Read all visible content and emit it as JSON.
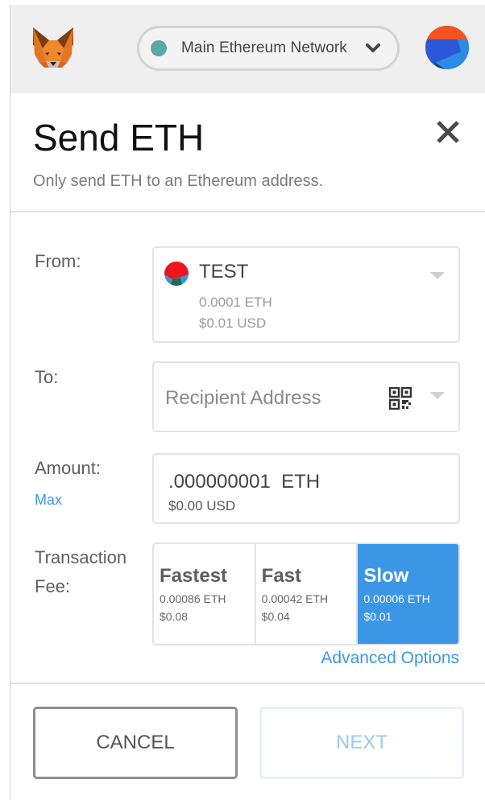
{
  "header": {
    "network_label": "Main Ethereum Network",
    "network_status_color": "#5aa8a5"
  },
  "page": {
    "title": "Send ETH",
    "subtitle": "Only send ETH to an Ethereum address."
  },
  "form": {
    "from_label": "From:",
    "from_account": {
      "name": "TEST",
      "balance_eth": "0.0001 ETH",
      "balance_usd": "$0.01 USD"
    },
    "to_label": "To:",
    "to_placeholder": "Recipient Address",
    "to_value": "",
    "amount_label": "Amount:",
    "max_link": "Max",
    "amount_value": ".000000001  ETH",
    "amount_usd": "$0.00 USD",
    "fee_label_line1": "Transaction",
    "fee_label_line2": "Fee:",
    "fee_options": [
      {
        "name": "Fastest",
        "eth": "0.00086 ETH",
        "usd": "$0.08",
        "selected": false
      },
      {
        "name": "Fast",
        "eth": "0.00042 ETH",
        "usd": "$0.04",
        "selected": false
      },
      {
        "name": "Slow",
        "eth": "0.00006 ETH",
        "usd": "$0.01",
        "selected": true
      }
    ],
    "advanced_options": "Advanced Options"
  },
  "footer": {
    "cancel_label": "CANCEL",
    "next_label": "NEXT"
  },
  "colors": {
    "accent": "#3b97e6",
    "link": "#3d99e2"
  }
}
